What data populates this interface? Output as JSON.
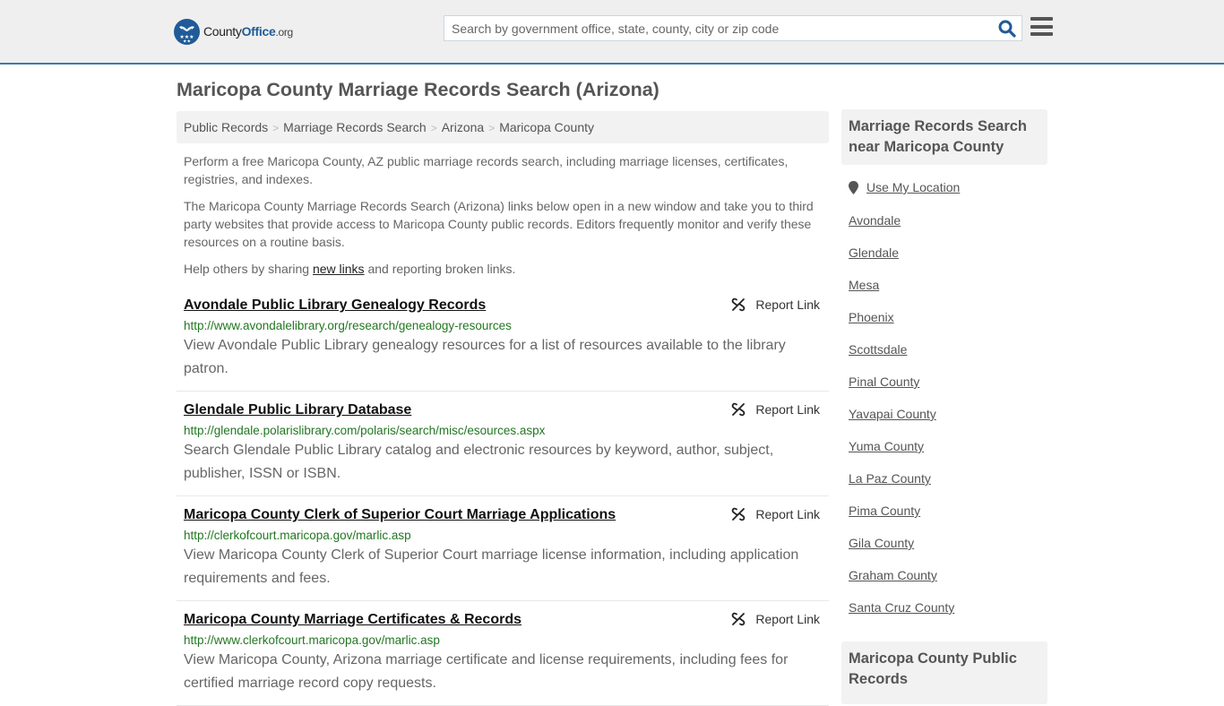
{
  "header": {
    "logo": {
      "name_part1": "County",
      "name_part2": "Office",
      "name_part3": ".org"
    },
    "search": {
      "placeholder": "Search by government office, state, county, city or zip code",
      "value": ""
    },
    "icons": {
      "search": "search-icon",
      "menu": "hamburger-menu-icon"
    },
    "accent_color": "#3a7cb0",
    "brand_color": "#1f5b98"
  },
  "page": {
    "title": "Maricopa County Marriage Records Search (Arizona)",
    "breadcrumb": [
      {
        "label": "Public Records"
      },
      {
        "label": "Marriage Records Search"
      },
      {
        "label": "Arizona"
      },
      {
        "label": "Maricopa County"
      }
    ],
    "breadcrumb_separator": ">",
    "intro": {
      "p1": "Perform a free Maricopa County, AZ public marriage records search, including marriage licenses, certificates, registries, and indexes.",
      "p2": "The Maricopa County Marriage Records Search (Arizona) links below open in a new window and take you to third party websites that provide access to Maricopa County public records. Editors frequently monitor and verify these resources on a routine basis.",
      "p3_before": "Help others by sharing ",
      "p3_link": "new links",
      "p3_after": " and reporting broken links."
    }
  },
  "results": [
    {
      "title": "Avondale Public Library Genealogy Records",
      "url": "http://www.avondalelibrary.org/research/genealogy-resources",
      "description": "View Avondale Public Library genealogy resources for a list of resources available to the library patron.",
      "report_label": "Report Link"
    },
    {
      "title": "Glendale Public Library Database",
      "url": "http://glendale.polarislibrary.com/polaris/search/misc/esources.aspx",
      "description": "Search Glendale Public Library catalog and electronic resources by keyword, author, subject, publisher, ISSN or ISBN.",
      "report_label": "Report Link"
    },
    {
      "title": "Maricopa County Clerk of Superior Court Marriage Applications",
      "url": "http://clerkofcourt.maricopa.gov/marlic.asp",
      "description": "View Maricopa County Clerk of Superior Court marriage license information, including application requirements and fees.",
      "report_label": "Report Link"
    },
    {
      "title": "Maricopa County Marriage Certificates & Records",
      "url": "http://www.clerkofcourt.maricopa.gov/marlic.asp",
      "description": "View Maricopa County, Arizona marriage certificate and license requirements, including fees for certified marriage record copy requests.",
      "report_label": "Report Link"
    }
  ],
  "sidebar": {
    "nearby_heading": "Marriage Records Search near Maricopa County",
    "use_location": "Use My Location",
    "nearby_links": [
      "Avondale",
      "Glendale",
      "Mesa",
      "Phoenix",
      "Scottsdale",
      "Pinal County",
      "Yavapai County",
      "Yuma County",
      "La Paz County",
      "Pima County",
      "Gila County",
      "Graham County",
      "Santa Cruz County"
    ],
    "public_records_heading": "Maricopa County Public Records"
  }
}
